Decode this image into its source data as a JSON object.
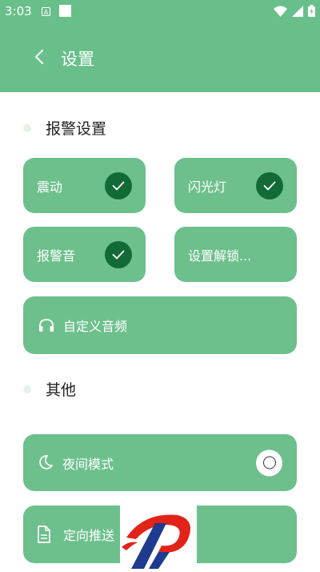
{
  "status_bar": {
    "time": "3:03",
    "notification_letter": "A"
  },
  "header": {
    "title": "设置"
  },
  "sections": {
    "alarm": "报警设置",
    "other": "其他"
  },
  "alarm_options": {
    "vibrate": {
      "label": "震动",
      "checked": true
    },
    "flashlight": {
      "label": "闪光灯",
      "checked": true
    },
    "alarm_sound": {
      "label": "报警音",
      "checked": true
    },
    "unlock_settings": {
      "label": "设置解锁..."
    },
    "custom_audio": {
      "label": "自定义音频",
      "icon": "headphones-icon"
    }
  },
  "other_options": {
    "night_mode": {
      "label": "夜间模式",
      "icon": "moon-icon",
      "enabled": false
    },
    "directed_push": {
      "label": "定向推送",
      "icon": "document-icon"
    }
  },
  "colors": {
    "primary": "#69bf8a",
    "card": "#6dc08c",
    "check_fill": "#126b36",
    "logo_red": "#e2231a",
    "logo_blue": "#1f3b8f"
  }
}
